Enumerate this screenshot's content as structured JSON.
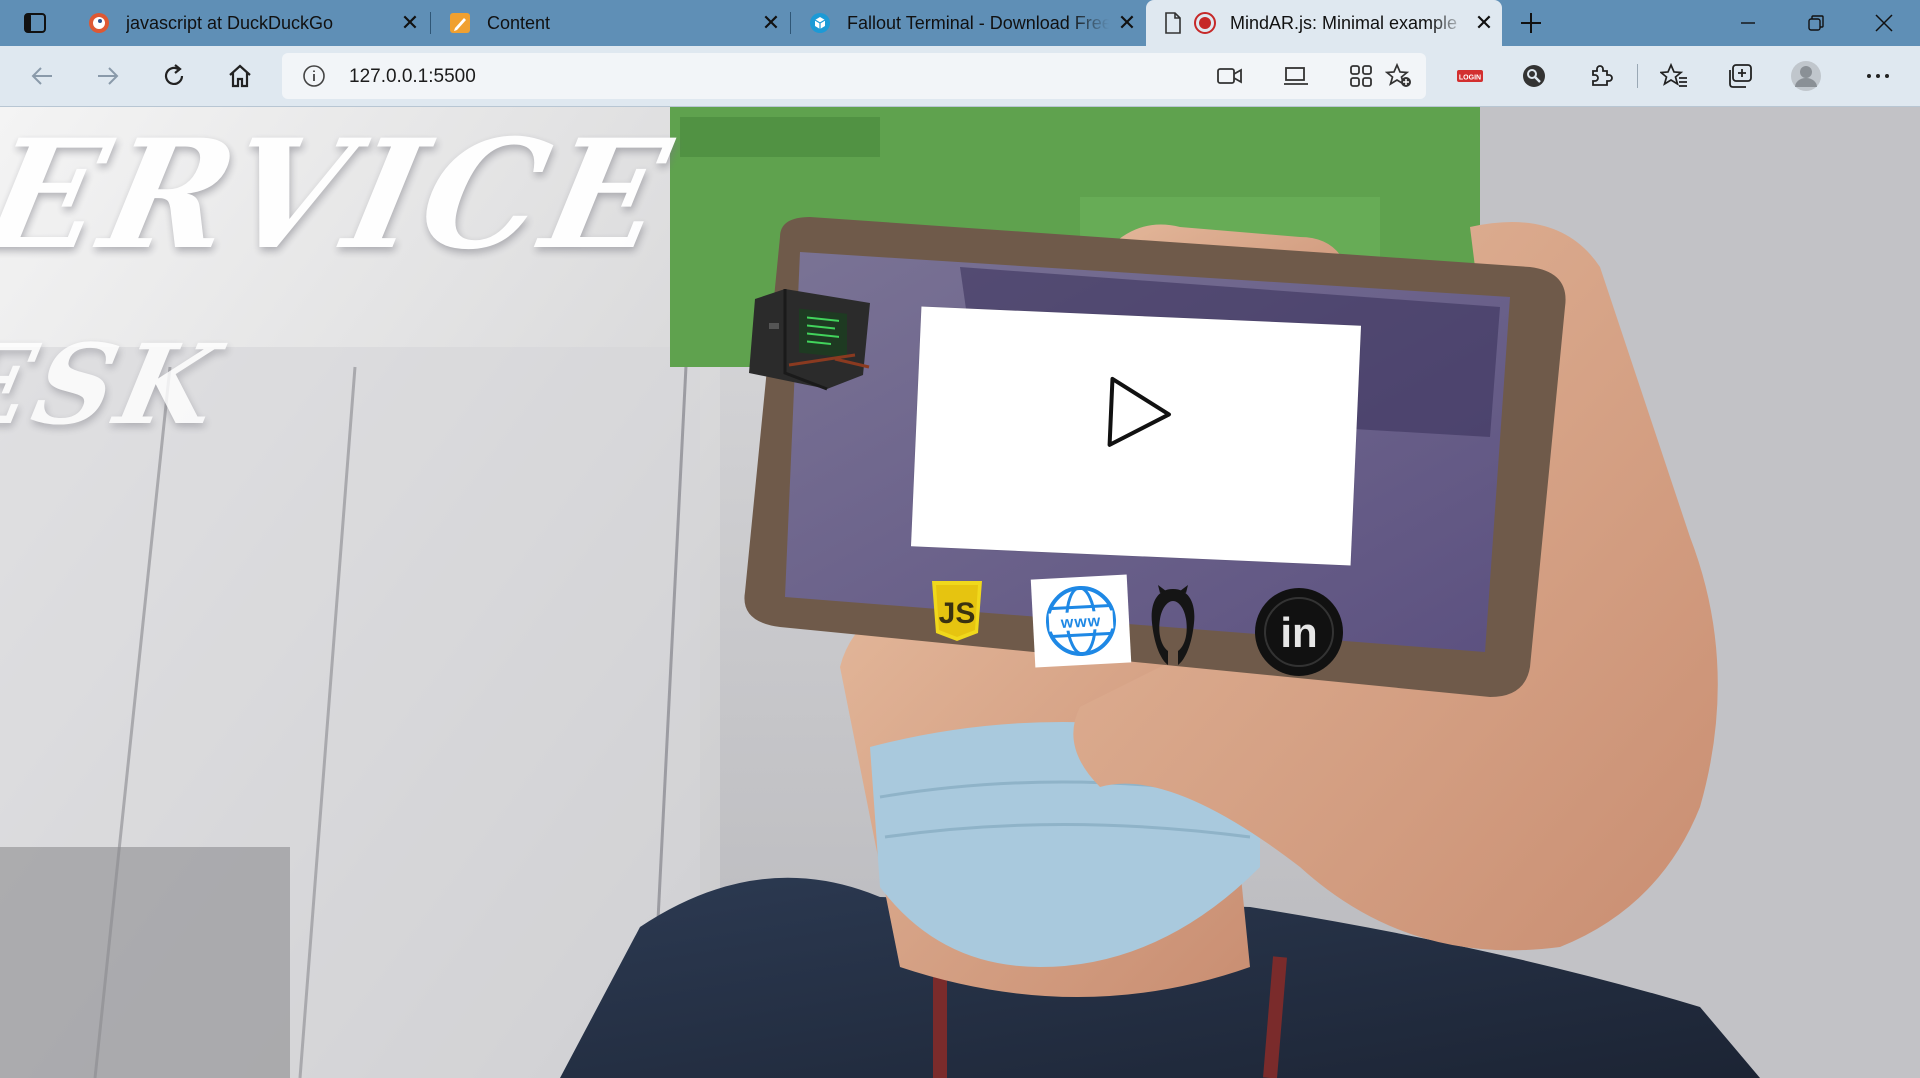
{
  "tabs": [
    {
      "title": "javascript at DuckDuckGo",
      "favicon": "duckduckgo-icon",
      "active": false
    },
    {
      "title": "Content",
      "favicon": "pencil-note-icon",
      "active": false
    },
    {
      "title": "Fallout Terminal - Download Free",
      "favicon": "cube-icon",
      "active": false
    },
    {
      "title": "MindAR.js: Minimal example",
      "favicon": "recording-icon",
      "active": true
    }
  ],
  "toolbar": {
    "url": "127.0.0.1:5500",
    "icons": [
      "back-icon",
      "forward-icon",
      "refresh-icon",
      "home-icon",
      "site-info-icon",
      "camera-icon",
      "app-available-icon",
      "qr-code-icon",
      "add-favorite-icon",
      "login-extension-icon",
      "search-extension-icon",
      "extensions-icon",
      "favorites-icon",
      "collections-icon",
      "profile-avatar",
      "more-menu-icon"
    ]
  },
  "page": {
    "background_sign": "ERVICE",
    "background_sign_line2": "ESK",
    "ar_overlay": {
      "video_button": "play-icon",
      "model": "fallout-terminal-3d-model",
      "links": [
        "javascript-icon",
        "website-www-icon",
        "github-icon",
        "linkedin-icon"
      ],
      "linkedin_text": "in",
      "www_text": "www",
      "js_text": "JS"
    }
  },
  "colors": {
    "tabbar": "#5f8fb6",
    "toolbar": "#dfe8f0",
    "omnibox": "#f2f5f8",
    "js_yellow": "#f0d81c",
    "www_blue": "#1e88e5"
  }
}
